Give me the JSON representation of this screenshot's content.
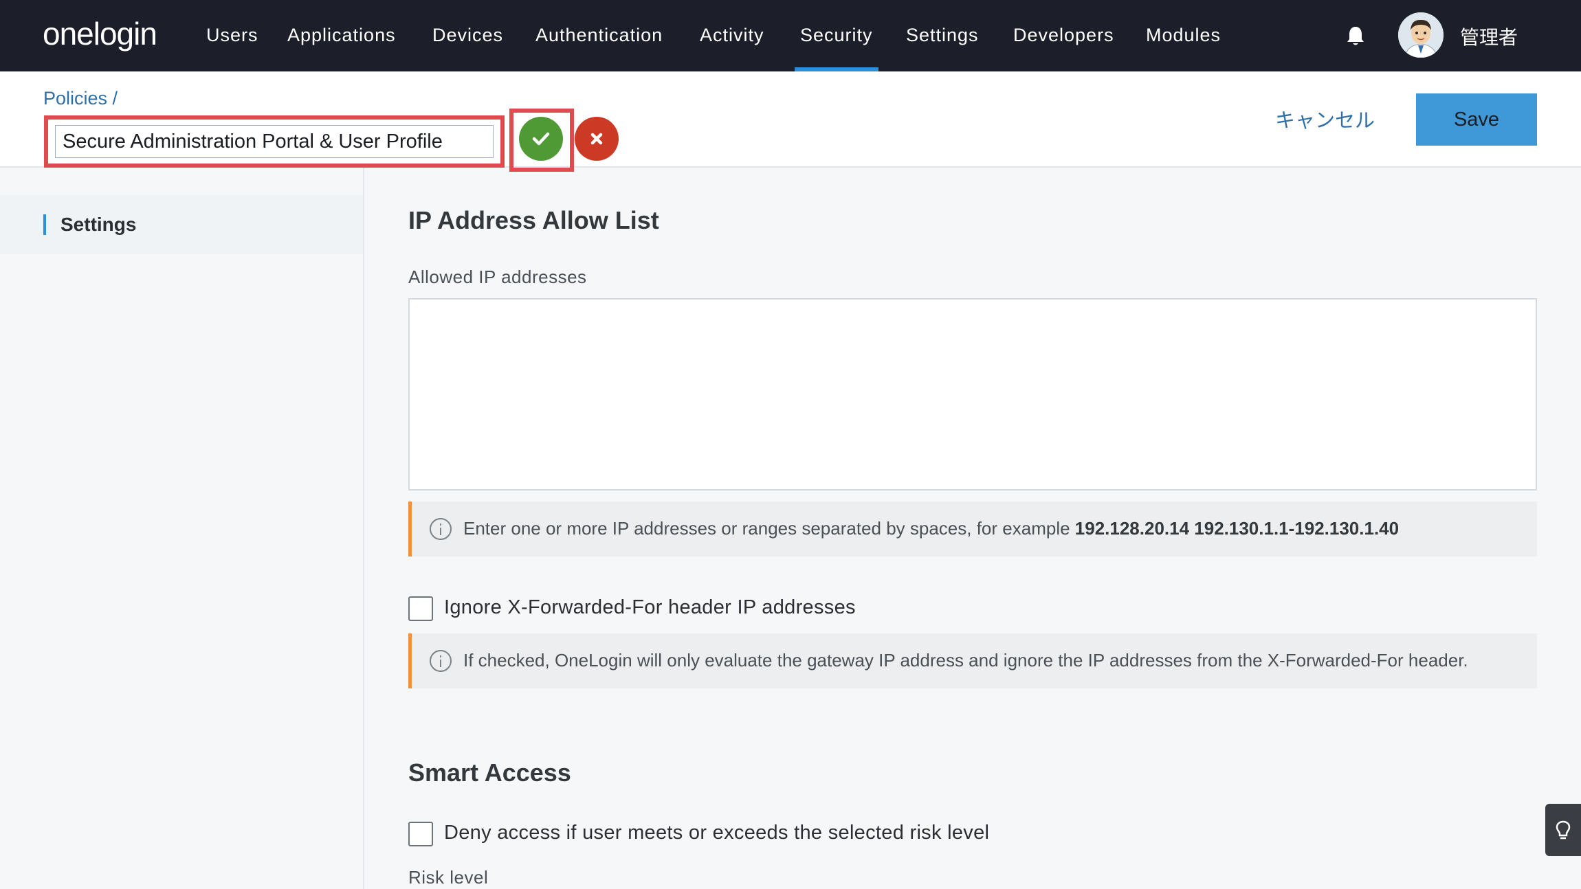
{
  "nav": {
    "logo": "onelogin",
    "items": [
      {
        "label": "Users"
      },
      {
        "label": "Applications"
      },
      {
        "label": "Devices"
      },
      {
        "label": "Authentication"
      },
      {
        "label": "Activity"
      },
      {
        "label": "Security"
      },
      {
        "label": "Settings"
      },
      {
        "label": "Developers"
      },
      {
        "label": "Modules"
      }
    ],
    "active_item": "Security",
    "user_name": "管理者",
    "icons": {
      "notifications": "bell-icon",
      "avatar": "avatar"
    }
  },
  "header": {
    "breadcrumb": "Policies /",
    "policy_name": "Secure Administration Portal & User Profile",
    "cancel_label": "キャンセル",
    "save_label": "Save",
    "icons": {
      "confirm": "check-icon",
      "discard": "close-icon"
    }
  },
  "sidebar": {
    "items": [
      {
        "label": "Settings"
      }
    ]
  },
  "main": {
    "ip_section": {
      "title": "IP Address Allow List",
      "field_label": "Allowed IP addresses",
      "field_value": "",
      "hint_prefix": "Enter one or more IP addresses or ranges separated by spaces, for example ",
      "hint_example": "192.128.20.14 192.130.1.1-192.130.1.40"
    },
    "xff": {
      "label": "Ignore X-Forwarded-For header IP addresses",
      "checked": false,
      "hint": "If checked, OneLogin will only evaluate the gateway IP address and ignore the IP addresses from the X-Forwarded-For header."
    },
    "smart_access": {
      "title": "Smart Access",
      "deny_label": "Deny access if user meets or exceeds the selected risk level",
      "deny_checked": false,
      "risk_label": "Risk level"
    }
  },
  "colors": {
    "nav_bg": "#1c1f2a",
    "accent": "#2e8fd6",
    "highlight_border": "#e04b4f",
    "confirm_green": "#4f9a34",
    "discard_red": "#cc3a26",
    "info_border": "#f0923b"
  }
}
